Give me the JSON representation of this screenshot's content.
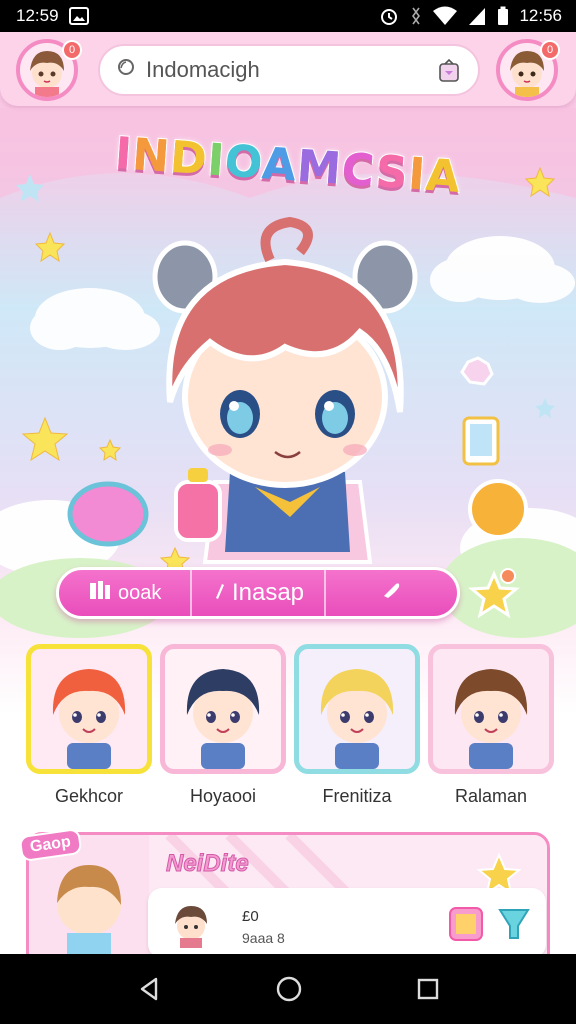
{
  "status_bar": {
    "time": "12:59",
    "right_time": "12:56"
  },
  "header": {
    "search_text": "Indomacigh",
    "left_badge": "0",
    "right_badge": "0"
  },
  "title": {
    "letters": [
      "I",
      "N",
      "D",
      "I",
      "O",
      "A",
      "M",
      "C",
      "S",
      "I",
      "A"
    ],
    "colors": [
      "#f56aa8",
      "#f59a3c",
      "#f2c230",
      "#7bd06a",
      "#44c2d6",
      "#4e9be6",
      "#9b6be0",
      "#e35fd0",
      "#f56aa8",
      "#f59a3c",
      "#f2c230"
    ]
  },
  "nav_pills": [
    {
      "icon": "book-icon",
      "label": "ooak"
    },
    {
      "icon": "pencil-icon",
      "label": "Inasap"
    },
    {
      "icon": "heart-icon",
      "label": ""
    }
  ],
  "characters": [
    {
      "name": "Gekhcor",
      "hair": "#f0603e",
      "frame": "#f7e23a",
      "bg": "#ffe9f2"
    },
    {
      "name": "Hoyaooi",
      "hair": "#2e3d63",
      "frame": "#f8b7d6",
      "bg": "#fff1f6"
    },
    {
      "name": "Frenitiza",
      "hair": "#f3d35b",
      "frame": "#8fdde3",
      "bg": "#f5eefb"
    },
    {
      "name": "Ralaman",
      "hair": "#7d4a2c",
      "frame": "#f8c2dd",
      "bg": "#fde7f2"
    }
  ],
  "panel": {
    "tag": "Gaop",
    "title": "NeiDite",
    "message_name": "£0",
    "message_sub": "9aaa 8"
  },
  "colors": {
    "accent_pink": "#f06cc4",
    "panel_border": "#f58bc3"
  }
}
